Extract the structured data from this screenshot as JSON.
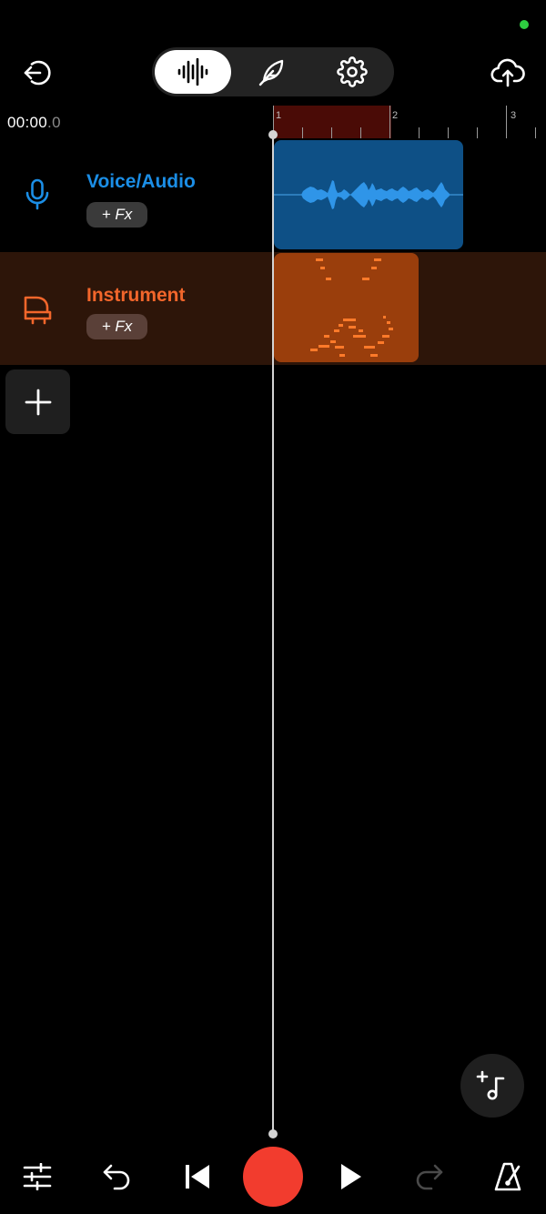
{
  "status": {
    "indicator_color": "#2ecc40"
  },
  "header": {
    "back_icon": "exit-arrow-icon",
    "modes": [
      {
        "name": "waveform",
        "icon": "waveform-icon",
        "active": true
      },
      {
        "name": "quill",
        "icon": "feather-icon",
        "active": false
      },
      {
        "name": "settings",
        "icon": "gear-icon",
        "active": false
      }
    ],
    "upload_icon": "cloud-upload-icon"
  },
  "timeline": {
    "time_main": "00:00",
    "time_fraction": ".0",
    "ruler_labels": [
      "1",
      "2",
      "3"
    ]
  },
  "tracks": [
    {
      "name": "Voice/Audio",
      "fx_label": "+ Fx",
      "icon": "microphone-icon",
      "color": "#1b8ee6",
      "clip_color": "#0e5086"
    },
    {
      "name": "Instrument",
      "fx_label": "+ Fx",
      "icon": "piano-icon",
      "color": "#f2662b",
      "clip_color": "#9a3e0c"
    }
  ],
  "add_track_icon": "plus-icon",
  "fab_icon": "add-note-icon",
  "transport": {
    "record_color": "#f23c2e",
    "buttons": [
      "mixer-icon",
      "undo-icon",
      "skip-to-start-icon",
      "record-button",
      "play-icon",
      "redo-icon",
      "metronome-icon"
    ]
  }
}
